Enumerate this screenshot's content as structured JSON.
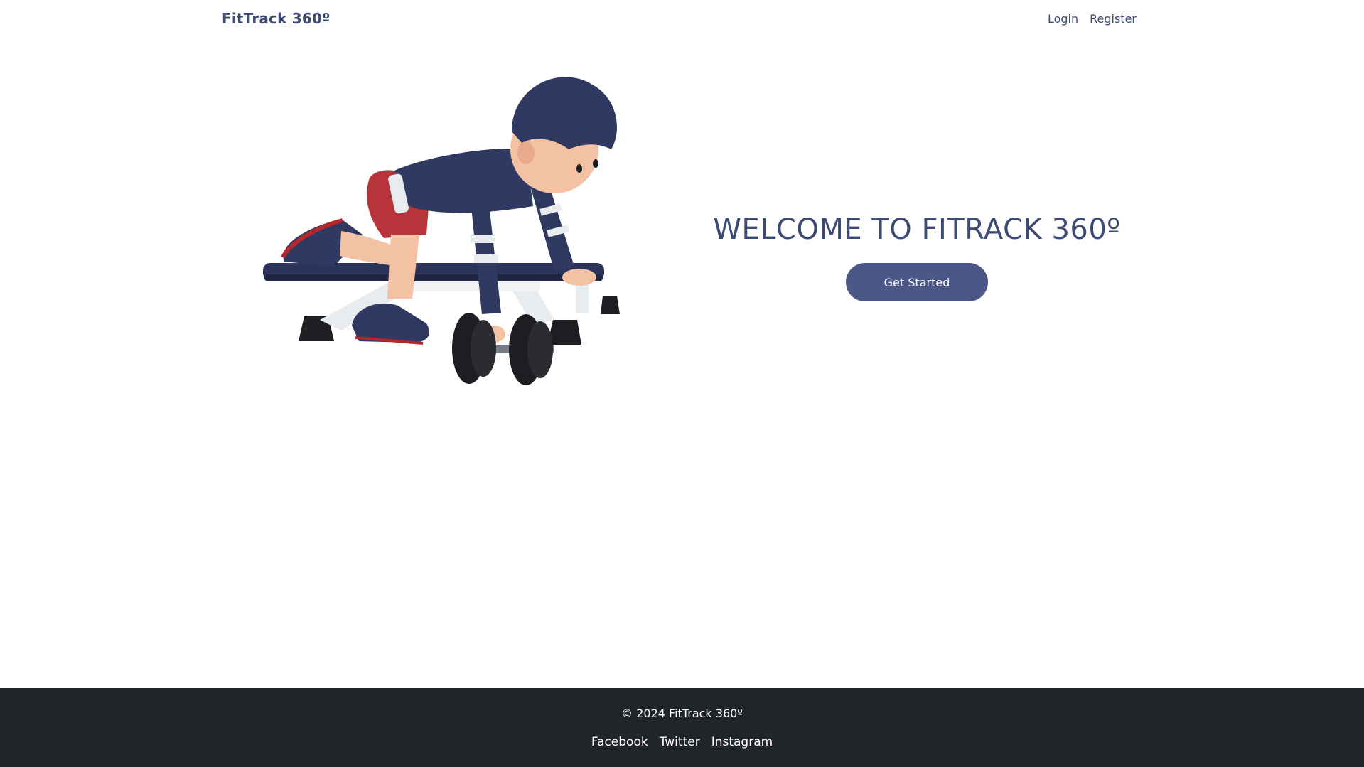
{
  "navbar": {
    "brand": "FitTrack 360º",
    "links": [
      "Login",
      "Register"
    ]
  },
  "hero": {
    "illustration": "person-with-dumbbell-on-bench-illustration",
    "title": "WELCOME TO FITRACK 360º",
    "cta_label": "Get Started"
  },
  "footer": {
    "copyright": "© 2024 FitTrack 360º",
    "social": [
      "Facebook",
      "Twitter",
      "Instagram"
    ]
  },
  "colors": {
    "primary": "#3d4a72",
    "button": "#4b5788",
    "footer_bg": "#212429",
    "background": "#ffffff"
  }
}
